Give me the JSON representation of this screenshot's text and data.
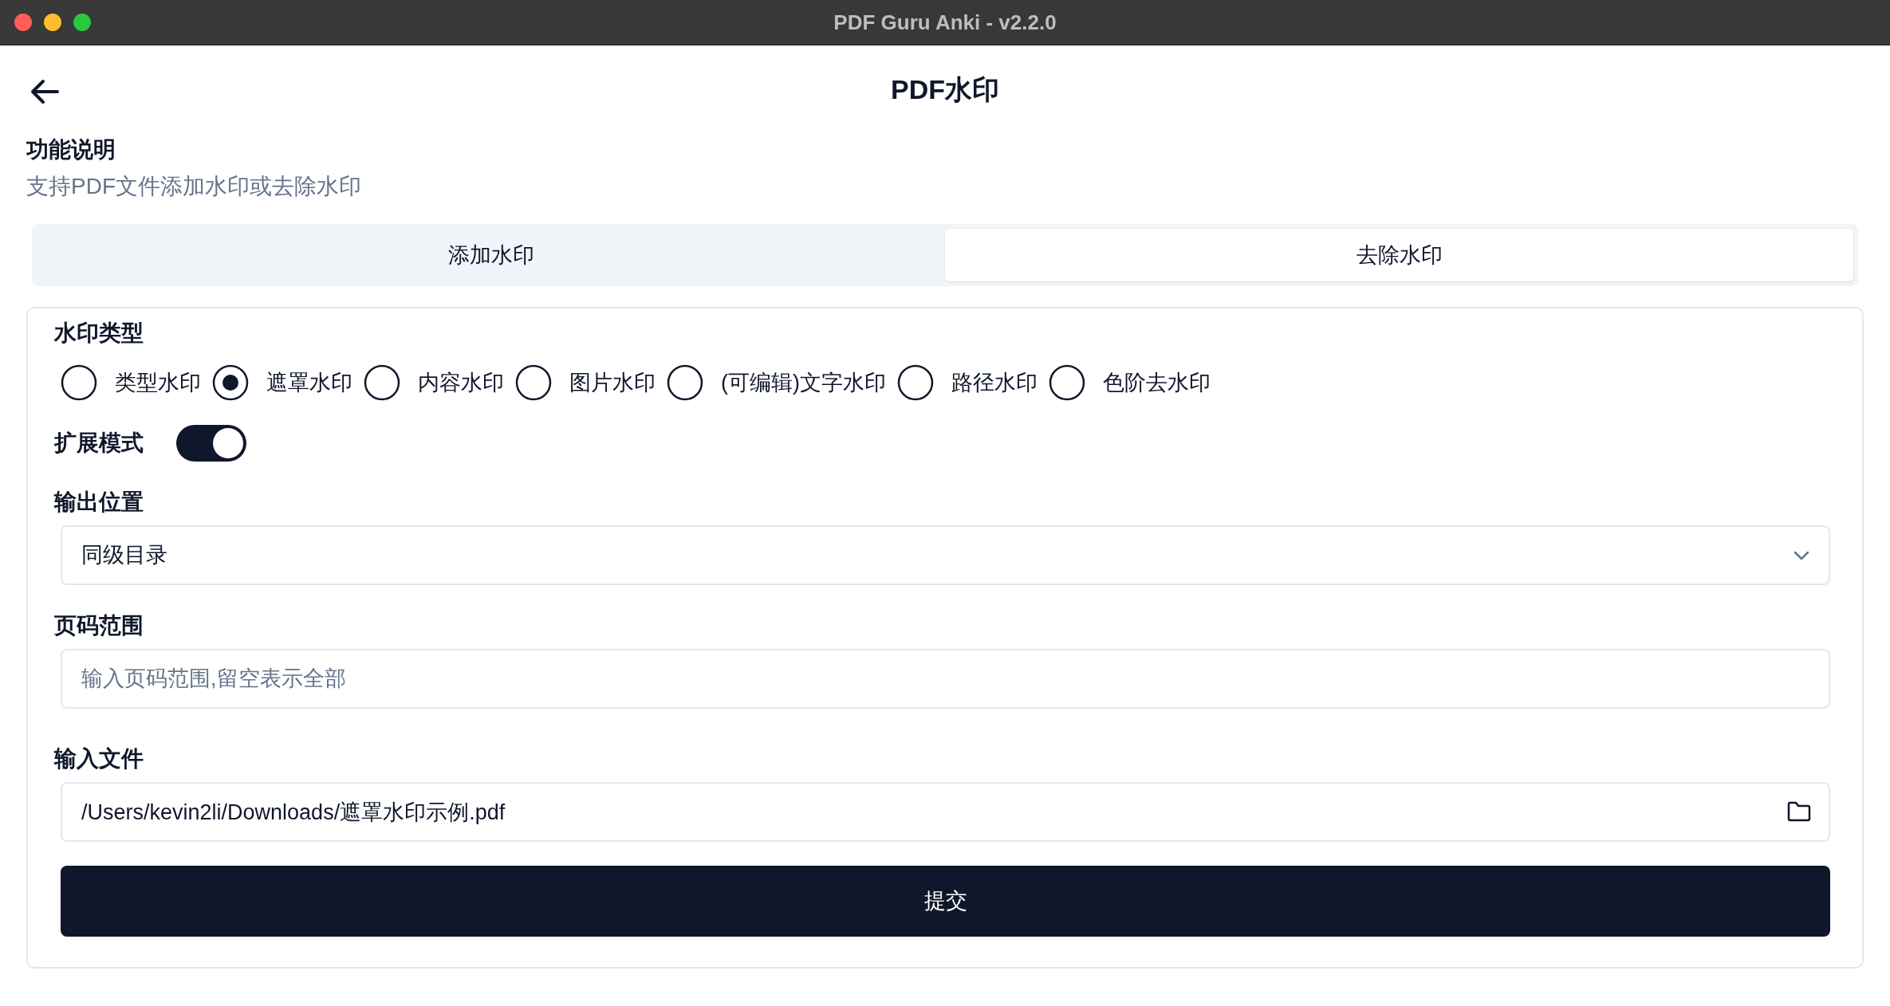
{
  "window": {
    "title": "PDF Guru Anki - v2.2.0"
  },
  "page": {
    "title": "PDF水印"
  },
  "description": {
    "heading": "功能说明",
    "text": "支持PDF文件添加水印或去除水印"
  },
  "tabs": [
    {
      "label": "添加水印",
      "selected": false
    },
    {
      "label": "去除水印",
      "selected": true
    }
  ],
  "form": {
    "watermark_type": {
      "label": "水印类型",
      "options": [
        {
          "label": "类型水印",
          "selected": false
        },
        {
          "label": "遮罩水印",
          "selected": true
        },
        {
          "label": "内容水印",
          "selected": false
        },
        {
          "label": "图片水印",
          "selected": false
        },
        {
          "label": "(可编辑)文字水印",
          "selected": false
        },
        {
          "label": "路径水印",
          "selected": false
        },
        {
          "label": "色阶去水印",
          "selected": false
        }
      ]
    },
    "extended_mode": {
      "label": "扩展模式",
      "on": true
    },
    "output_location": {
      "label": "输出位置",
      "value": "同级目录"
    },
    "page_range": {
      "label": "页码范围",
      "placeholder": "输入页码范围,留空表示全部"
    },
    "input_file": {
      "label": "输入文件",
      "value": "/Users/kevin2li/Downloads/遮罩水印示例.pdf"
    },
    "submit": "提交"
  }
}
